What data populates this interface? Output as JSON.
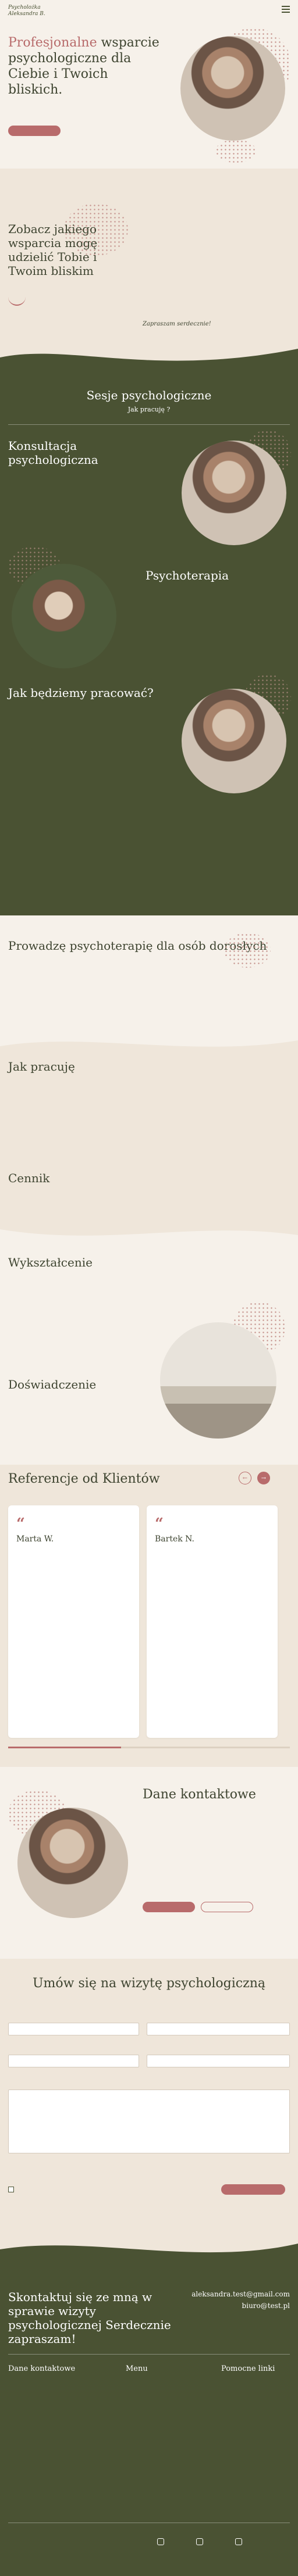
{
  "brand": {
    "logo_line1": "Psycholożka",
    "logo_line2": "Aleksandra B."
  },
  "hero": {
    "title_accent": "Profesjonalne",
    "title_rest": " wsparcie psychologiczne dla Ciebie i Twoich bliskich.",
    "body": "",
    "cta_label": ""
  },
  "support": {
    "title": "Zobacz jakiego wsparcia mogę udzielić Tobie i Twoim bliskim",
    "body": "",
    "closing": "Zapraszam serdecznie!"
  },
  "services": {
    "title": "Sesje psychologiczne",
    "subtitle": "Jak pracuję ?"
  },
  "consult": {
    "title": "Konsultacja psychologiczna",
    "body": ""
  },
  "therapy": {
    "title": "Psychoterapia",
    "body": ""
  },
  "howwork": {
    "title": "Jak będziemy pracować?",
    "body": ""
  },
  "adults": {
    "title": "Prowadzę psychoterapię dla osób dorosłych",
    "items": [
      "",
      "",
      ""
    ]
  },
  "howiwork": {
    "title": "Jak pracuję",
    "items": [
      "",
      "",
      ""
    ]
  },
  "pricing": {
    "title": "Cennik",
    "line": ""
  },
  "education": {
    "title": "Wykształcenie",
    "body": ""
  },
  "experience": {
    "title": "Doświadczenie",
    "body": ""
  },
  "reviews": {
    "title": "Referencje od Klientów",
    "cards": [
      {
        "name": "Marta W.",
        "text": ""
      },
      {
        "name": "Bartek N.",
        "text": ""
      }
    ]
  },
  "contact": {
    "title": "Dane kontaktowe",
    "body": "",
    "btn_primary": "",
    "btn_secondary": ""
  },
  "form": {
    "title": "Umów się na wizytę psychologiczną",
    "consent": "",
    "submit": ""
  },
  "footer_cta": {
    "text": "Skontaktuj się ze mną w sprawie wizyty psychologicznej Serdecznie zapraszam!",
    "email": "aleksandra.test@gmail.com",
    "email2": "biuro@test.pl"
  },
  "footer": {
    "col1_title": "Dane kontaktowe",
    "col2_title": "Menu",
    "col3_title": "Pomocne linki",
    "copyright": ""
  },
  "colors": {
    "olive": "#4a5233",
    "accent": "#b86b6b",
    "cream": "#f6f1ea"
  }
}
